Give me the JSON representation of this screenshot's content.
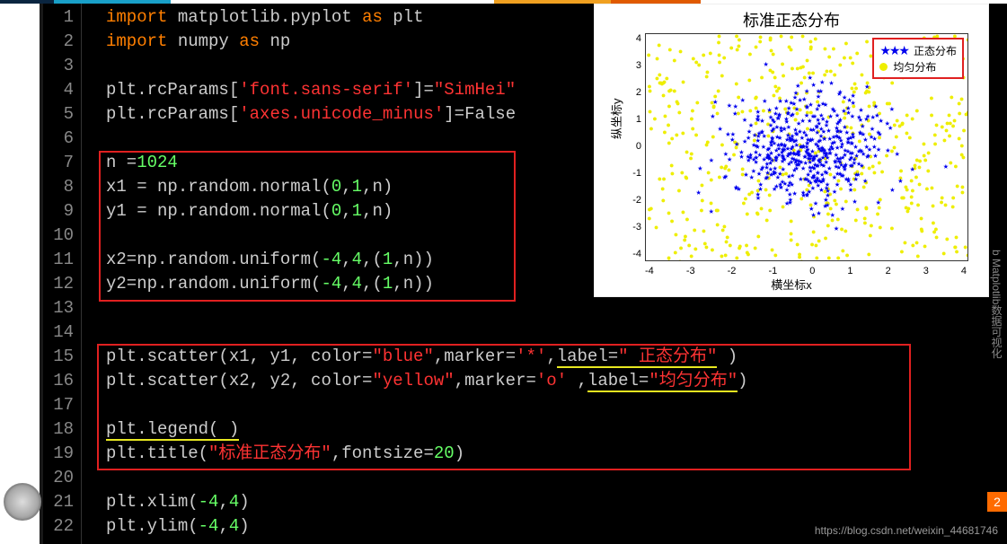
{
  "topbar_colors": [
    "#0a2540",
    "#19a0c9",
    "#ffffff",
    "#f0a020",
    "#e05a00",
    "#ffffff"
  ],
  "code_lines": [
    {
      "n": 1,
      "tokens": [
        {
          "t": "import ",
          "c": "kw"
        },
        {
          "t": "matplotlib.pyplot ",
          "c": "fn"
        },
        {
          "t": "as ",
          "c": "kw"
        },
        {
          "t": "plt",
          "c": "fn"
        }
      ]
    },
    {
      "n": 2,
      "tokens": [
        {
          "t": "import ",
          "c": "kw"
        },
        {
          "t": "numpy ",
          "c": "fn"
        },
        {
          "t": "as ",
          "c": "kw"
        },
        {
          "t": "np",
          "c": "fn"
        }
      ]
    },
    {
      "n": 3,
      "tokens": []
    },
    {
      "n": 4,
      "tokens": [
        {
          "t": "plt.rcParams[",
          "c": "fn"
        },
        {
          "t": "'font.sans-serif'",
          "c": "str"
        },
        {
          "t": "]=",
          "c": "fn"
        },
        {
          "t": "\"SimHei\"",
          "c": "str"
        }
      ]
    },
    {
      "n": 5,
      "tokens": [
        {
          "t": "plt.rcParams[",
          "c": "fn"
        },
        {
          "t": "'axes.unicode_minus'",
          "c": "str"
        },
        {
          "t": "]=False",
          "c": "fn"
        }
      ]
    },
    {
      "n": 6,
      "tokens": []
    },
    {
      "n": 7,
      "tokens": [
        {
          "t": "n =",
          "c": "fn"
        },
        {
          "t": "1024",
          "c": "num"
        }
      ]
    },
    {
      "n": 8,
      "tokens": [
        {
          "t": "x1 = np.random.normal(",
          "c": "fn"
        },
        {
          "t": "0",
          "c": "num"
        },
        {
          "t": ",",
          "c": "fn"
        },
        {
          "t": "1",
          "c": "num"
        },
        {
          "t": ",n)",
          "c": "fn"
        }
      ]
    },
    {
      "n": 9,
      "tokens": [
        {
          "t": "y1 = np.random.normal(",
          "c": "fn"
        },
        {
          "t": "0",
          "c": "num"
        },
        {
          "t": ",",
          "c": "fn"
        },
        {
          "t": "1",
          "c": "num"
        },
        {
          "t": ",n)",
          "c": "fn"
        }
      ]
    },
    {
      "n": 10,
      "tokens": []
    },
    {
      "n": 11,
      "tokens": [
        {
          "t": "x2=np.random.uniform(",
          "c": "fn"
        },
        {
          "t": "-4",
          "c": "num"
        },
        {
          "t": ",",
          "c": "fn"
        },
        {
          "t": "4",
          "c": "num"
        },
        {
          "t": ",(",
          "c": "fn"
        },
        {
          "t": "1",
          "c": "num"
        },
        {
          "t": ",n))",
          "c": "fn"
        }
      ]
    },
    {
      "n": 12,
      "tokens": [
        {
          "t": "y2=np.random.uniform(",
          "c": "fn"
        },
        {
          "t": "-4",
          "c": "num"
        },
        {
          "t": ",",
          "c": "fn"
        },
        {
          "t": "4",
          "c": "num"
        },
        {
          "t": ",(",
          "c": "fn"
        },
        {
          "t": "1",
          "c": "num"
        },
        {
          "t": ",n))",
          "c": "fn"
        }
      ]
    },
    {
      "n": 13,
      "tokens": []
    },
    {
      "n": 14,
      "tokens": []
    },
    {
      "n": 15,
      "tokens": [
        {
          "t": "plt.scatter(x1, y1, color=",
          "c": "fn"
        },
        {
          "t": "\"blue\"",
          "c": "str"
        },
        {
          "t": ",marker=",
          "c": "fn"
        },
        {
          "t": "'*'",
          "c": "str"
        },
        {
          "t": ",",
          "c": "fn"
        },
        {
          "t": "label=",
          "c": "fn",
          "u": 1
        },
        {
          "t": "\"  正态分布\"",
          "c": "str",
          "u": 1
        },
        {
          "t": " )",
          "c": "fn"
        }
      ]
    },
    {
      "n": 16,
      "tokens": [
        {
          "t": "plt.scatter(x2, y2, color=",
          "c": "fn"
        },
        {
          "t": "\"yellow\"",
          "c": "str"
        },
        {
          "t": ",marker=",
          "c": "fn"
        },
        {
          "t": "'o'",
          "c": "str"
        },
        {
          "t": " ,",
          "c": "fn"
        },
        {
          "t": "label=",
          "c": "fn",
          "u": 1
        },
        {
          "t": "\"均匀分布\"",
          "c": "str",
          "u": 1
        },
        {
          "t": ")",
          "c": "fn"
        }
      ]
    },
    {
      "n": 17,
      "tokens": []
    },
    {
      "n": 18,
      "tokens": [
        {
          "t": "plt.legend( )",
          "c": "fn",
          "u": 1
        }
      ]
    },
    {
      "n": 19,
      "tokens": [
        {
          "t": "plt.title(",
          "c": "fn"
        },
        {
          "t": "\"标准正态分布\"",
          "c": "str"
        },
        {
          "t": ",fontsize=",
          "c": "fn"
        },
        {
          "t": "20",
          "c": "num"
        },
        {
          "t": ")",
          "c": "fn"
        }
      ]
    },
    {
      "n": 20,
      "tokens": []
    },
    {
      "n": 21,
      "tokens": [
        {
          "t": "plt.xlim(",
          "c": "fn"
        },
        {
          "t": "-4",
          "c": "num"
        },
        {
          "t": ",",
          "c": "fn"
        },
        {
          "t": "4",
          "c": "num"
        },
        {
          "t": ")",
          "c": "fn"
        }
      ]
    },
    {
      "n": 22,
      "tokens": [
        {
          "t": "plt.ylim(",
          "c": "fn"
        },
        {
          "t": "-4",
          "c": "num"
        },
        {
          "t": ",",
          "c": "fn"
        },
        {
          "t": "4",
          "c": "num"
        },
        {
          "t": ")",
          "c": "fn"
        }
      ]
    }
  ],
  "legend": {
    "normal": "正态分布",
    "uniform": "均匀分布"
  },
  "sidebar_text": "b Matplotlib数据可视化",
  "page_badge": "2",
  "watermark": "https://blog.csdn.net/weixin_44681746",
  "chart_data": {
    "type": "scatter",
    "title": "标准正态分布",
    "xlabel": "横坐标x",
    "ylabel": "纵坐标y",
    "xlim": [
      -4,
      4
    ],
    "ylim": [
      -4,
      4
    ],
    "xticks": [
      -4,
      -3,
      -2,
      -1,
      0,
      1,
      2,
      3,
      4
    ],
    "yticks": [
      -4,
      -3,
      -2,
      -1,
      0,
      1,
      2,
      3,
      4
    ],
    "series": [
      {
        "name": "正态分布",
        "marker": "*",
        "color": "#0000ee",
        "distribution": "normal",
        "mu": 0,
        "sigma": 1,
        "n": 1024
      },
      {
        "name": "均匀分布",
        "marker": "o",
        "color": "#eeee00",
        "distribution": "uniform",
        "low": -4,
        "high": 4,
        "n": 1024
      }
    ]
  }
}
